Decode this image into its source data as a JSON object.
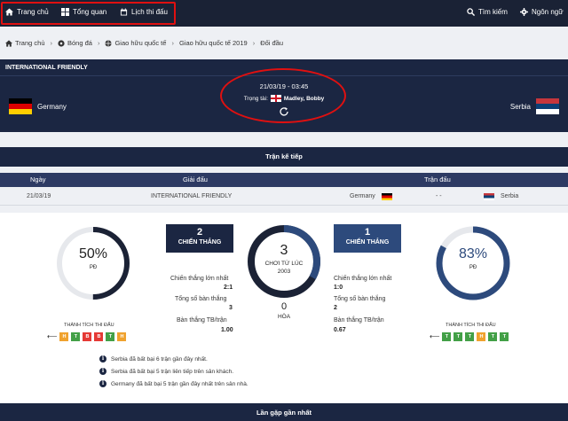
{
  "nav": {
    "home": "Trang chủ",
    "overview": "Tổng quan",
    "schedule": "Lịch thi đấu",
    "search": "Tìm kiếm",
    "language": "Ngôn ngữ"
  },
  "breadcrumb": [
    "Trang chủ",
    "Bóng đá",
    "Giao hữu quốc tế",
    "Giao hữu quốc tế 2019",
    "Đối đầu"
  ],
  "match": {
    "competition": "INTERNATIONAL FRIENDLY",
    "datetime": "21/03/19 - 03:45",
    "referee_label": "Trọng tài:",
    "referee": "Madley, Bobby",
    "home_team": "Germany",
    "away_team": "Serbia"
  },
  "next_match": {
    "title": "Trận kế tiếp",
    "headers": {
      "date": "Ngày",
      "competition": "Giải đấu",
      "match": "Trận đấu"
    },
    "row": {
      "date": "21/03/19",
      "competition": "INTERNATIONAL FRIENDLY",
      "home": "Germany",
      "score": "- -",
      "away": "Serbia"
    }
  },
  "head_to_head": {
    "home_pct": "50%",
    "home_pct_value": 50,
    "home_pct_label": "PĐ",
    "away_pct": "83%",
    "away_pct_value": 83,
    "away_pct_label": "PĐ",
    "home_wins": "2",
    "away_wins": "1",
    "wins_label": "CHIẾN THẮNG",
    "played": "3",
    "played_label": "CHƠI TỪ LÚC",
    "since": "2003",
    "draws": "0",
    "draws_label": "HÒA",
    "home_stats": [
      {
        "label": "Chiến thắng lớn nhất",
        "value": "2:1"
      },
      {
        "label": "Tổng số bàn thắng",
        "value": "3"
      },
      {
        "label": "Bàn thắng TB/trận",
        "value": "1.00"
      }
    ],
    "away_stats": [
      {
        "label": "Chiến thắng lớn nhất",
        "value": "1:0"
      },
      {
        "label": "Tổng số bàn thắng",
        "value": "2"
      },
      {
        "label": "Bàn thắng TB/trận",
        "value": "0.67"
      }
    ],
    "form_title": "THÀNH TÍCH THI ĐẤU",
    "home_form": [
      "H",
      "T",
      "B",
      "B",
      "T",
      "H"
    ],
    "away_form": [
      "T",
      "T",
      "T",
      "H",
      "T",
      "T"
    ],
    "colors": {
      "win": "#43a047",
      "draw": "#f0a22e",
      "loss": "#e53935",
      "accent": "#2d4a7c"
    }
  },
  "notes": [
    "Serbia đã bất bại 6 trận gần đây nhất.",
    "Serbia đã bất bại 5 trận liên tiếp trên sân khách.",
    "Germany đã bất bại 5 trận gần đây nhất trên sân nhà."
  ],
  "last_meetings": {
    "title": "Lần gặp gần nhất"
  }
}
